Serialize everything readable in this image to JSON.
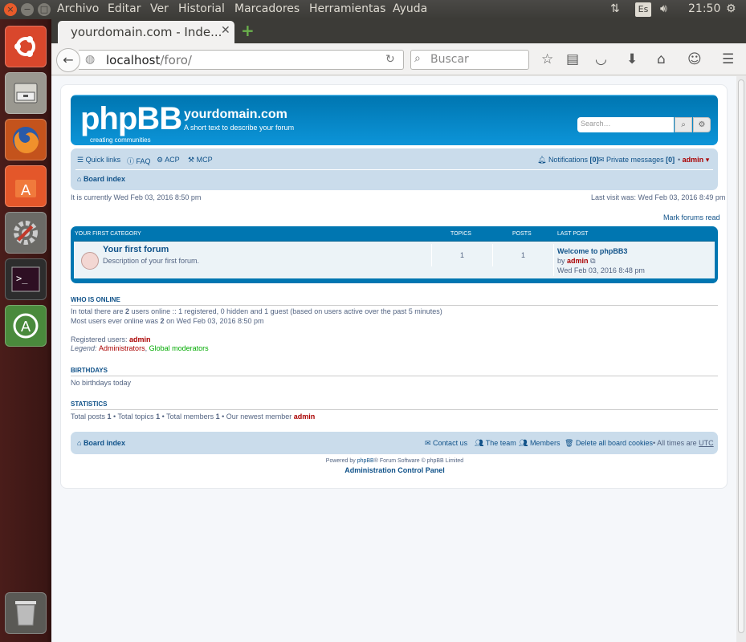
{
  "top_panel": {
    "menus": [
      "Archivo",
      "Editar",
      "Ver",
      "Historial",
      "Marcadores",
      "Herramientas",
      "Ayuda"
    ],
    "keyboard": "Es",
    "clock": "21:50"
  },
  "browser": {
    "tab_title": "yourdomain.com - Inde...",
    "url_host": "localhost",
    "url_path": "/foro/",
    "search_placeholder": "Buscar"
  },
  "forum": {
    "logo": "phpBB",
    "logo_sub": "creating    communities",
    "site_title": "yourdomain.com",
    "site_desc": "A short text to describe your forum",
    "search_placeholder": "Search…",
    "nav": {
      "quick_links": "Quick links",
      "faq": "FAQ",
      "acp": "ACP",
      "mcp": "MCP",
      "notifications": "Notifications",
      "notifications_count": "[0]",
      "pm": "Private messages",
      "pm_count": "[0]",
      "user": "admin",
      "board_index": "Board index"
    },
    "current_time": "It is currently Wed Feb 03, 2016 8:50 pm",
    "last_visit": "Last visit was: Wed Feb 03, 2016 8:49 pm",
    "mark_read": "Mark forums read",
    "category": {
      "title": "YOUR FIRST CATEGORY",
      "col_topics": "TOPICS",
      "col_posts": "POSTS",
      "col_last": "LAST POST",
      "forum_name": "Your first forum",
      "forum_desc": "Description of your first forum.",
      "topics": "1",
      "posts": "1",
      "last_title": "Welcome to phpBB3",
      "last_by": "by",
      "last_user": "admin",
      "last_date": "Wed Feb 03, 2016 8:48 pm"
    },
    "online": {
      "title": "WHO IS ONLINE",
      "line1a": "In total there are ",
      "line1b": "2",
      "line1c": " users online :: 1 registered, 0 hidden and 1 guest (based on users active over the past 5 minutes)",
      "line2a": "Most users ever online was ",
      "line2b": "2",
      "line2c": " on Wed Feb 03, 2016 8:50 pm",
      "registered_label": "Registered users: ",
      "registered_user": "admin",
      "legend_label": "Legend: ",
      "legend_admins": "Administrators",
      "legend_sep": ", ",
      "legend_mods": "Global moderators"
    },
    "birthdays": {
      "title": "BIRTHDAYS",
      "text": "No birthdays today"
    },
    "stats": {
      "title": "STATISTICS",
      "p1": "Total posts ",
      "posts": "1",
      "p2": " • Total topics ",
      "topics": "1",
      "p3": " • Total members ",
      "members": "1",
      "p4": " • Our newest member ",
      "newest": "admin"
    },
    "footer": {
      "board_index": "Board index",
      "contact": "Contact us",
      "team": "The team",
      "members": "Members",
      "delete_cookies": "Delete all board cookies",
      "times": "• All times are ",
      "tz": "UTC",
      "powered_a": "Powered by ",
      "powered_link": "phpBB",
      "powered_b": "® Forum Software © phpBB Limited",
      "acp": "Administration Control Panel"
    }
  },
  "colors": {
    "header_blue": "#12a3eb",
    "nav_bg": "#cadceb",
    "link": "#105289",
    "admin_red": "#aa0000"
  }
}
